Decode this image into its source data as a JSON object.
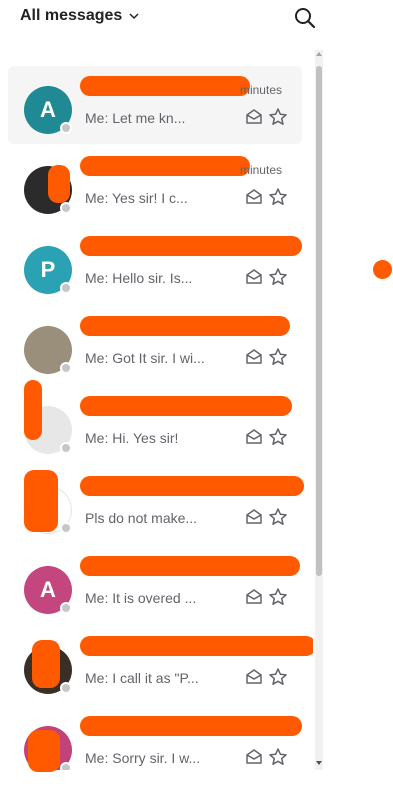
{
  "header": {
    "title": "All messages",
    "title_icon": "chevron-down-icon",
    "search_icon": "search-icon"
  },
  "conversations": [
    {
      "initial": "A",
      "avatar_color": "#1f8a93",
      "time": "minutes",
      "preview": "Me: Let me kn...",
      "active": true
    },
    {
      "initial": "",
      "avatar_color": "#2b2b2b",
      "time": "minutes",
      "preview": "Me: Yes sir! I c...",
      "active": false
    },
    {
      "initial": "P",
      "avatar_color": "#2aa2b3",
      "time": "",
      "preview": "Me: Hello sir. Is...",
      "active": false
    },
    {
      "initial": "",
      "avatar_color": "#9a8f7a",
      "time": "",
      "preview": "Me: Got It sir. I wi...",
      "active": false
    },
    {
      "initial": "",
      "avatar_color": "#e7e7e7",
      "time": "",
      "preview": "Me: Hi. Yes sir!",
      "active": false
    },
    {
      "initial": "",
      "avatar_color": "#ffffff",
      "time": "",
      "preview": "Pls do not make...",
      "active": false
    },
    {
      "initial": "A",
      "avatar_color": "#c4467e",
      "time": "",
      "preview": "Me: It is overed ...",
      "active": false
    },
    {
      "initial": "",
      "avatar_color": "#3a2f26",
      "time": "",
      "preview": "Me: I call it as \"P...",
      "active": false
    },
    {
      "initial": "",
      "avatar_color": "#c2437a",
      "time": "",
      "preview": "Me: Sorry sir. I w...",
      "active": false
    }
  ],
  "colors": {
    "redaction": "#ff5a00",
    "online_dot": "#c5c6c9",
    "active_row": "#f5f5f5"
  }
}
